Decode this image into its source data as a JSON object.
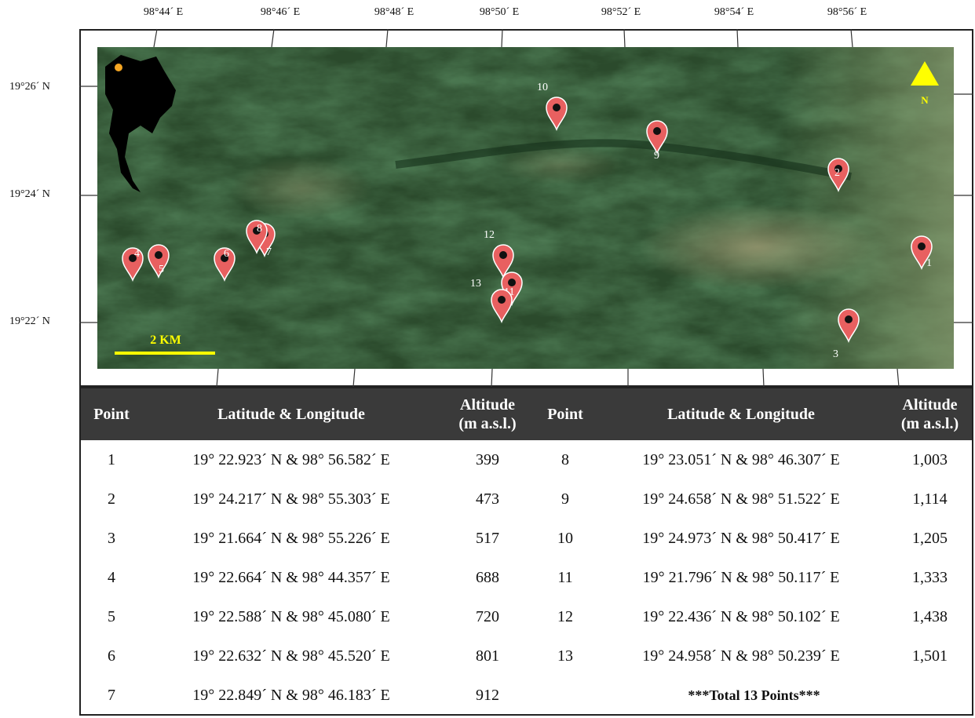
{
  "map": {
    "lon_labels": [
      "98°44´ E",
      "98°46´ E",
      "98°48´ E",
      "98°50´ E",
      "98°52´ E",
      "98°54´ E",
      "98°56´ E"
    ],
    "lat_labels": [
      "19°26´ N",
      "19°24´ N",
      "19°22´ N"
    ],
    "north_label": "N",
    "scale_label": "2 KM",
    "marker_color": "#e85a5a",
    "scale_color": "#ffff00",
    "locator_dot_color": "#f5a623",
    "markers": [
      {
        "label": "1"
      },
      {
        "label": "2"
      },
      {
        "label": "3"
      },
      {
        "label": "4"
      },
      {
        "label": "5"
      },
      {
        "label": "6"
      },
      {
        "label": "7"
      },
      {
        "label": "8"
      },
      {
        "label": "9"
      },
      {
        "label": "10"
      },
      {
        "label": "11"
      },
      {
        "label": "12"
      },
      {
        "label": "13"
      }
    ]
  },
  "table": {
    "headers": {
      "point": "Point",
      "latlon": "Latitude & Longitude",
      "alt1": "Altitude",
      "alt2": "(m a.s.l.)"
    },
    "rows": [
      {
        "point": "1",
        "latlon": "19° 22.923´ N & 98° 56.582´ E",
        "alt": "399"
      },
      {
        "point": "2",
        "latlon": "19° 24.217´ N & 98° 55.303´ E",
        "alt": "473"
      },
      {
        "point": "3",
        "latlon": "19° 21.664´ N & 98° 55.226´ E",
        "alt": "517"
      },
      {
        "point": "4",
        "latlon": "19° 22.664´ N & 98° 44.357´ E",
        "alt": "688"
      },
      {
        "point": "5",
        "latlon": "19° 22.588´ N & 98° 45.080´ E",
        "alt": "720"
      },
      {
        "point": "6",
        "latlon": "19° 22.632´ N & 98° 45.520´ E",
        "alt": "801"
      },
      {
        "point": "7",
        "latlon": "19° 22.849´ N & 98° 46.183´ E",
        "alt": "912"
      },
      {
        "point": "8",
        "latlon": "19° 23.051´ N & 98° 46.307´ E",
        "alt": "1,003"
      },
      {
        "point": "9",
        "latlon": "19° 24.658´ N & 98° 51.522´ E",
        "alt": "1,114"
      },
      {
        "point": "10",
        "latlon": "19° 24.973´ N & 98° 50.417´ E",
        "alt": "1,205"
      },
      {
        "point": "11",
        "latlon": "19° 21.796´ N & 98° 50.117´ E",
        "alt": "1,333"
      },
      {
        "point": "12",
        "latlon": "19° 22.436´ N & 98° 50.102´ E",
        "alt": "1,438"
      },
      {
        "point": "13",
        "latlon": "19° 24.958´ N & 98° 50.239´ E",
        "alt": "1,501"
      }
    ],
    "total": "***Total 13 Points***"
  }
}
